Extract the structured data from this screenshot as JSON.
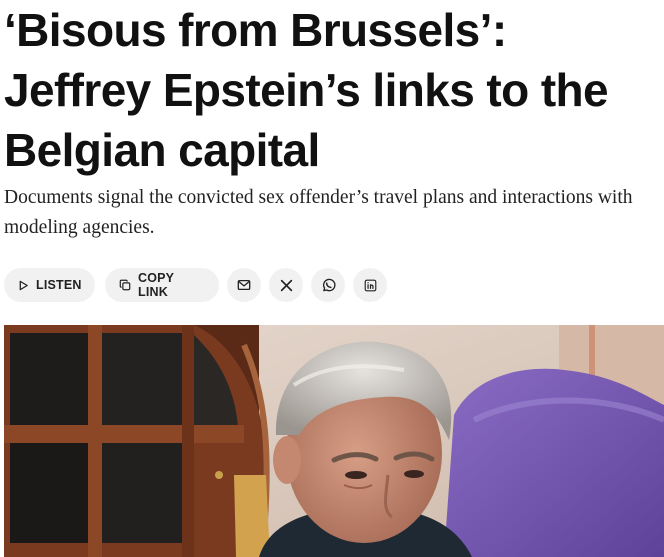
{
  "article": {
    "headline": "‘Bisous from Brussels’: Jeffrey Epstein’s links to the Belgian capital",
    "dek": "Documents signal the convicted sex offender’s travel plans and interactions with modeling agencies."
  },
  "share_bar": {
    "listen_label": "LISTEN",
    "copy_link_label": "COPY LINK",
    "icons": [
      "play-icon",
      "copy-icon",
      "email-icon",
      "x-logo-icon",
      "whatsapp-icon",
      "linkedin-icon"
    ]
  },
  "colors": {
    "text": "#111111",
    "pill_background": "#f1f1f1",
    "hero_wall": "#d9c8bc",
    "hero_chair": "#7a5db4",
    "hero_window_frame": "#6e2c17"
  }
}
